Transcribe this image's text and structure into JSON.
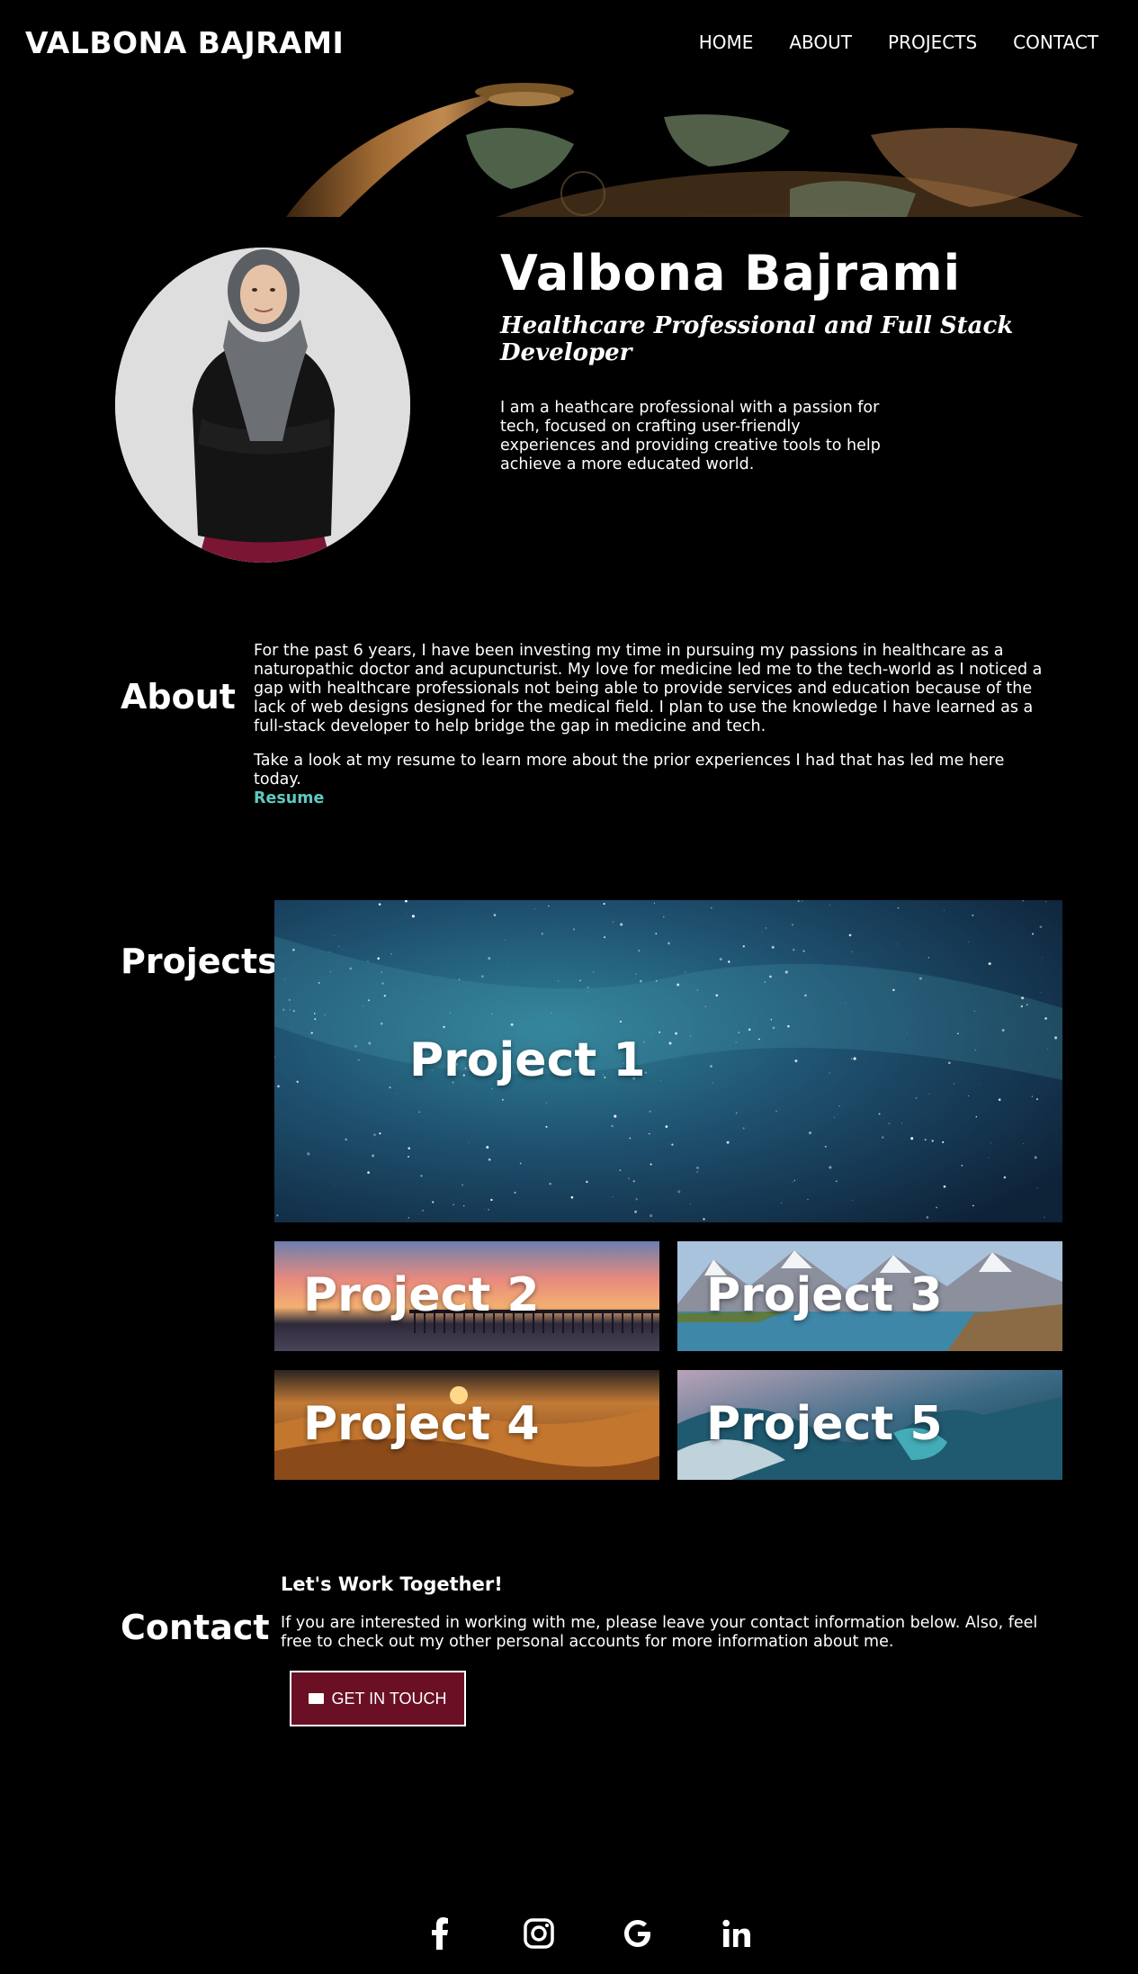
{
  "header": {
    "brand": "VALBONA BAJRAMI",
    "nav": [
      "HOME",
      "ABOUT",
      "PROJECTS",
      "CONTACT"
    ]
  },
  "hero": {
    "name": "Valbona Bajrami",
    "subtitle": "Healthcare Professional and Full Stack Developer",
    "description": "I am a heathcare professional with a passion for tech, focused on crafting user-friendly experiences and providing creative tools to help achieve a more educated world."
  },
  "about": {
    "title": "About",
    "paragraph1": "For the past 6 years, I have been investing my time in pursuing my passions in healthcare as a naturopathic doctor and acupuncturist. My love for medicine led me to the tech-world as I noticed a gap with healthcare professionals not being able to provide services and education because of the lack of web designs designed for the medical field. I plan to use the knowledge I have learned as a full-stack developer to help bridge the gap in medicine and tech.",
    "paragraph2": "Take a look at my resume to learn more about the prior experiences I had that has led me here today.",
    "resume_link": "Resume"
  },
  "projects": {
    "title": "Projects",
    "items": [
      "Project 1",
      "Project 2",
      "Project 3",
      "Project 4",
      "Project 5"
    ]
  },
  "contact": {
    "title": "Contact",
    "heading": "Let's Work Together!",
    "text": "If you are interested in working with me, please leave your contact information below. Also, feel free to check out my other personal accounts for more information about me.",
    "button": "GET IN TOUCH"
  },
  "socials": [
    "facebook-icon",
    "instagram-icon",
    "google-icon",
    "linkedin-icon"
  ],
  "colors": {
    "background": "#000000",
    "accent_link": "#5fc9c0",
    "button_bg": "#6b0f24"
  }
}
